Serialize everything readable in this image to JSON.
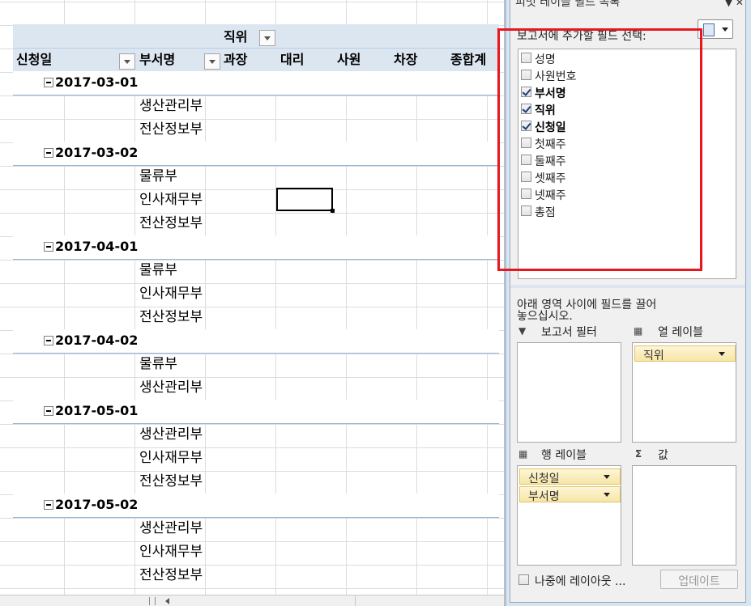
{
  "pivot": {
    "column_field": "직위",
    "row_header_1": "신청일",
    "row_header_2": "부서명",
    "columns": [
      "과장",
      "대리",
      "사원",
      "차장",
      "종합계"
    ],
    "groups": [
      {
        "date": "2017-03-01",
        "depts": [
          "생산관리부",
          "전산정보부"
        ]
      },
      {
        "date": "2017-03-02",
        "depts": [
          "물류부",
          "인사재무부",
          "전산정보부"
        ]
      },
      {
        "date": "2017-04-01",
        "depts": [
          "물류부",
          "인사재무부",
          "전산정보부"
        ]
      },
      {
        "date": "2017-04-02",
        "depts": [
          "물류부",
          "생산관리부"
        ]
      },
      {
        "date": "2017-05-01",
        "depts": [
          "생산관리부",
          "인사재무부",
          "전산정보부"
        ]
      },
      {
        "date": "2017-05-02",
        "depts": [
          "생산관리부",
          "인사재무부",
          "전산정보부"
        ]
      }
    ]
  },
  "field_panel": {
    "title": "피벗 테이블 필드 목록",
    "choose_label": "보고서에 추가할 필드 선택:",
    "fields": [
      {
        "label": "성명",
        "checked": false
      },
      {
        "label": "사원번호",
        "checked": false
      },
      {
        "label": "부서명",
        "checked": true
      },
      {
        "label": "직위",
        "checked": true
      },
      {
        "label": "신청일",
        "checked": true
      },
      {
        "label": "첫째주",
        "checked": false
      },
      {
        "label": "둘째주",
        "checked": false
      },
      {
        "label": "셋째주",
        "checked": false
      },
      {
        "label": "넷째주",
        "checked": false
      },
      {
        "label": "총점",
        "checked": false
      }
    ],
    "drag_hint_1": "아래 영역 사이에 필드를 끌어",
    "drag_hint_2": "놓으십시오.",
    "report_filter": "보고서 필터",
    "column_labels": "열 레이블",
    "row_labels": "행 레이블",
    "values": "값",
    "column_chips": [
      "직위"
    ],
    "row_chips": [
      "신청일",
      "부서명"
    ],
    "defer_label": "나중에 레이아웃 ...",
    "update_label": "업데이트"
  },
  "colors": {
    "highlight_box": "#e8171f",
    "pivot_header": "#dce6f1",
    "chip": "#f7e6a6"
  }
}
